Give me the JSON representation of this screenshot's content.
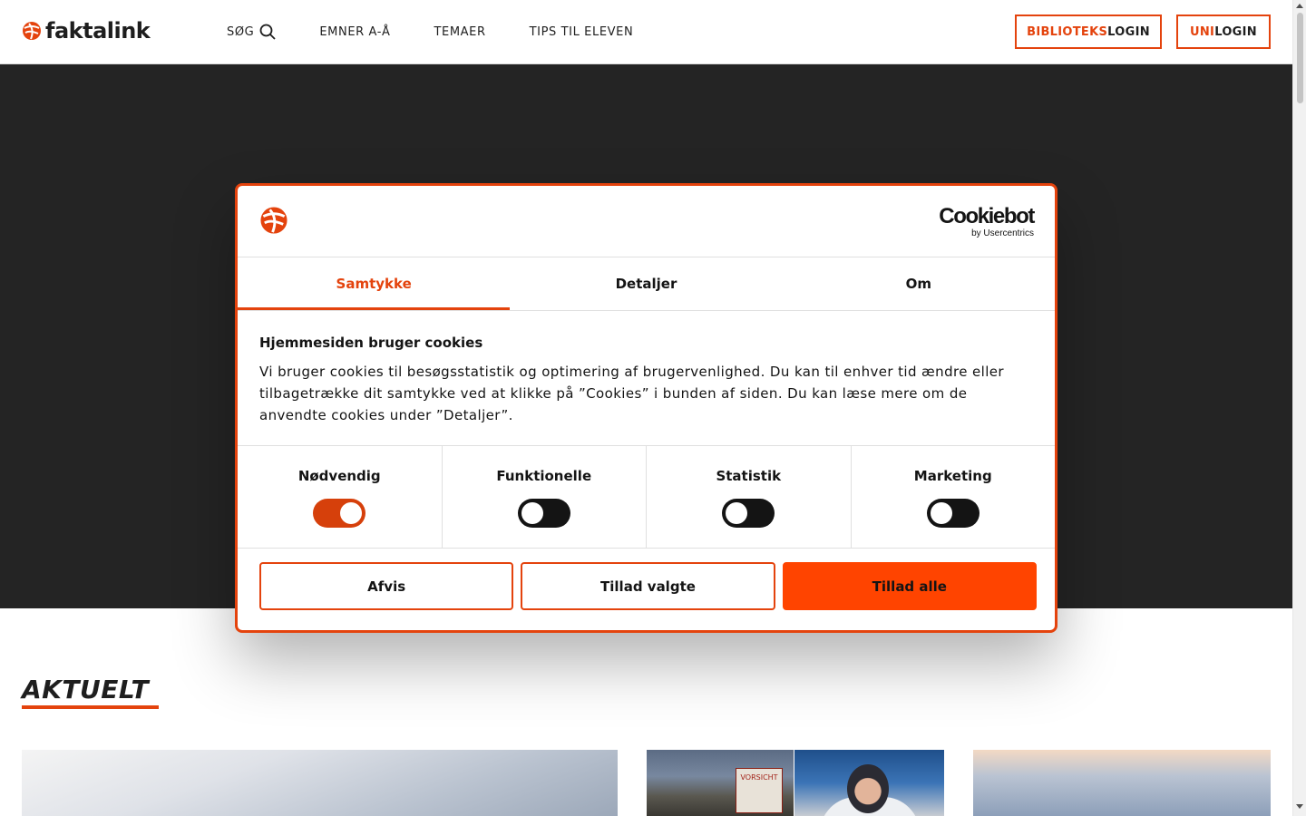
{
  "header": {
    "logo_text": "faktalink",
    "nav": [
      {
        "label": "SØG"
      },
      {
        "label": "EMNER A-Å"
      },
      {
        "label": "TEMAER"
      },
      {
        "label": "TIPS TIL ELEVEN"
      }
    ],
    "login_bibliotek": {
      "accent": "BIBLIOTEKS",
      "rest": "LOGIN"
    },
    "login_uni": {
      "accent": "UNI",
      "rest": "LOGIN"
    }
  },
  "section": {
    "title": "AKTUELT"
  },
  "cards": {
    "sign_text": "VORSICHT"
  },
  "dialog": {
    "brand": {
      "name": "Cookiebot",
      "by": "by Usercentrics"
    },
    "tabs": [
      {
        "label": "Samtykke",
        "active": true
      },
      {
        "label": "Detaljer",
        "active": false
      },
      {
        "label": "Om",
        "active": false
      }
    ],
    "heading": "Hjemmesiden bruger cookies",
    "body": "Vi bruger cookies til besøgsstatistik og optimering af brugervenlighed. Du kan til enhver tid ændre eller tilbagetrække dit samtykke ved at klikke på ”Cookies” i bunden af siden. Du kan læse mere om de anvendte cookies under ”Detaljer”.",
    "categories": [
      {
        "label": "Nødvendig",
        "enabled": true
      },
      {
        "label": "Funktionelle",
        "enabled": false
      },
      {
        "label": "Statistik",
        "enabled": false
      },
      {
        "label": "Marketing",
        "enabled": false
      }
    ],
    "buttons": {
      "reject": "Afvis",
      "allow_selected": "Tillad valgte",
      "allow_all": "Tillad alle"
    }
  },
  "colors": {
    "accent": "#e4430d",
    "primary_button": "#ff4400",
    "hero_bg": "#242424"
  },
  "icons": {
    "logo": "globe-logo-icon",
    "search": "search-icon"
  }
}
